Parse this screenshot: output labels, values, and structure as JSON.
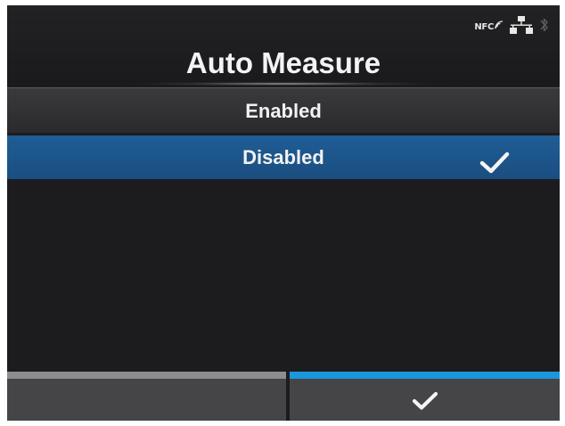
{
  "status_bar": {
    "nfc_label": "NFC",
    "icons": [
      "nfc-icon",
      "wired-network-icon",
      "bluetooth-icon"
    ]
  },
  "screen": {
    "title": "Auto Measure"
  },
  "options": {
    "items": [
      {
        "label": "Enabled",
        "selected": false
      },
      {
        "label": "Disabled",
        "selected": true
      }
    ],
    "selected_mark": "check-icon"
  },
  "softkeys": {
    "left": {
      "label": "",
      "bar_color": "#8d8d8f"
    },
    "right": {
      "icon": "check-icon",
      "bar_color": "#1b97de"
    }
  },
  "colors": {
    "background": "#1c1c1e",
    "selection": "#1f5d96",
    "accent": "#1b97de",
    "text": "#f2f2f2"
  }
}
